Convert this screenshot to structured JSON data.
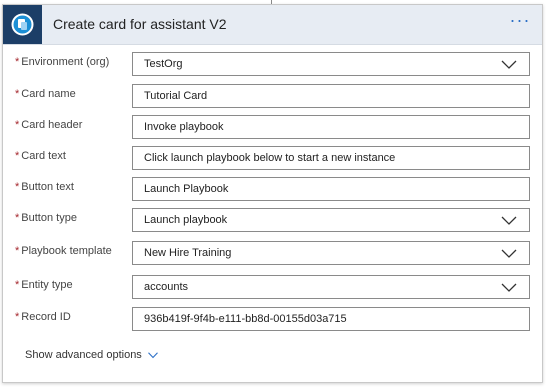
{
  "header": {
    "title": "Create card for assistant V2",
    "more_label": "···",
    "accent_color": "#2b6fc6",
    "logo_bg": "#1c3e67"
  },
  "fields": [
    {
      "label": "Environment (org)",
      "value": "TestOrg",
      "type": "dropdown",
      "required": true
    },
    {
      "label": "Card name",
      "value": "Tutorial Card",
      "type": "text",
      "required": true
    },
    {
      "label": "Card header",
      "value": "Invoke playbook",
      "type": "text",
      "required": true
    },
    {
      "label": "Card text",
      "value": "Click launch playbook below to start a new instance",
      "type": "text",
      "required": true
    },
    {
      "label": "Button text",
      "value": "Launch Playbook",
      "type": "text",
      "required": true
    },
    {
      "label": "Button type",
      "value": "Launch playbook",
      "type": "dropdown",
      "required": true
    },
    {
      "label": "Playbook template",
      "value": "New Hire Training",
      "type": "dropdown",
      "required": true
    },
    {
      "label": "Entity type",
      "value": "accounts",
      "type": "dropdown",
      "required": true
    },
    {
      "label": "Record ID",
      "value": "936b419f-9f4b-e111-bb8d-00155d03a715",
      "type": "text",
      "required": true
    }
  ],
  "required_marker": "*",
  "advanced_options_label": "Show advanced options"
}
